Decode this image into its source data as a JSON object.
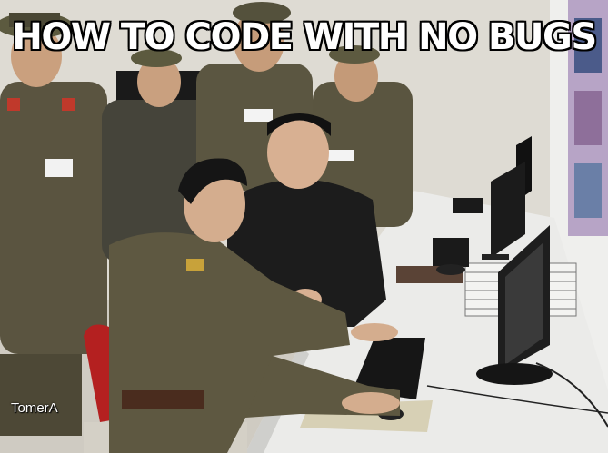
{
  "meme": {
    "caption": "HOW TO CODE WITH NO BUGS",
    "watermark": "TomerA"
  },
  "colors": {
    "uniform": "#5d5740",
    "uniform_dark": "#3f3a2b",
    "coat_black": "#1c1c1c",
    "desk": "#e9e9e7",
    "wall": "#e4e2dc",
    "chair_red": "#b42020"
  },
  "scene": {
    "description_icons": [
      "officer-figure",
      "soldier-typing",
      "leader-figure",
      "monitor",
      "keyboard",
      "mouse",
      "poster"
    ]
  }
}
